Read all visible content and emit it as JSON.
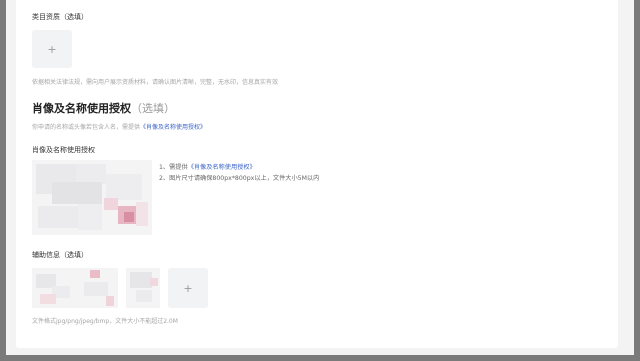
{
  "category_qualification": {
    "label": "类目资质（选填）",
    "upload_plus": "+",
    "hint": "依据相关法律法规，需向用户展示资质材料，请确认图片清晰，完整，无水印，信息真实有效"
  },
  "portrait_authorization": {
    "title": "肖像及名称使用授权",
    "optional": "（选填）",
    "desc_prefix": "你申请的名称或头像若包含人名，需提供",
    "desc_link": "《肖像及名称使用授权》",
    "field_label": "肖像及名称使用授权",
    "req_line1_prefix": "1、需提供",
    "req_line1_link": "《肖像及名称使用授权》",
    "req_line2": "2、图片尺寸请确保800px*800px以上，文件大小5M以内"
  },
  "auxiliary_info": {
    "label": "辅助信息（选填）",
    "upload_plus": "+",
    "hint": "文件格式jpg/png/jpeg/bmp，文件大小不能超过2.0M",
    "thumbnail_count": 3
  },
  "colors": {
    "link": "#3a64c8",
    "backdrop": "#7a7a7a"
  }
}
